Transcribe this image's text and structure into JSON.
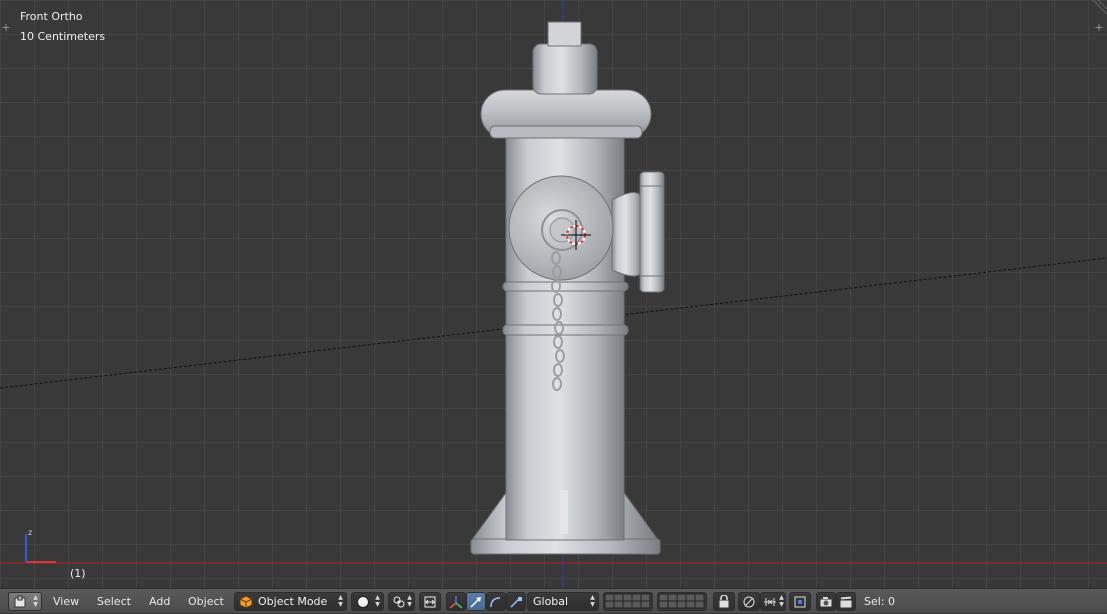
{
  "viewport": {
    "view_name": "Front Ortho",
    "scale_label": "10 Centimeters",
    "frame_label": "(1)",
    "axis_label": "z"
  },
  "header": {
    "menus": [
      "View",
      "Select",
      "Add",
      "Object"
    ],
    "mode": "Object Mode",
    "orientation": "Global",
    "selection_status": "Sel: 0"
  },
  "colors": {
    "background": "#393939",
    "grid": "#464646",
    "x_axis": "#8a2a2a",
    "z_axis": "#2a3a8a",
    "header": "#505050",
    "active_button": "#5a7ba8"
  },
  "icons": [
    "editor-type-3d-icon",
    "shading-solid-icon",
    "pivot-point-icon",
    "manipulator-toggle-icon",
    "translate-icon",
    "rotate-icon",
    "scale-icon",
    "layers-icon",
    "lock-camera-icon",
    "proportional-edit-icon",
    "snap-icon",
    "snap-target-icon",
    "render-icon",
    "clapper-icon",
    "object-icon",
    "axis-gizmo-icon",
    "cursor-3d-icon"
  ]
}
